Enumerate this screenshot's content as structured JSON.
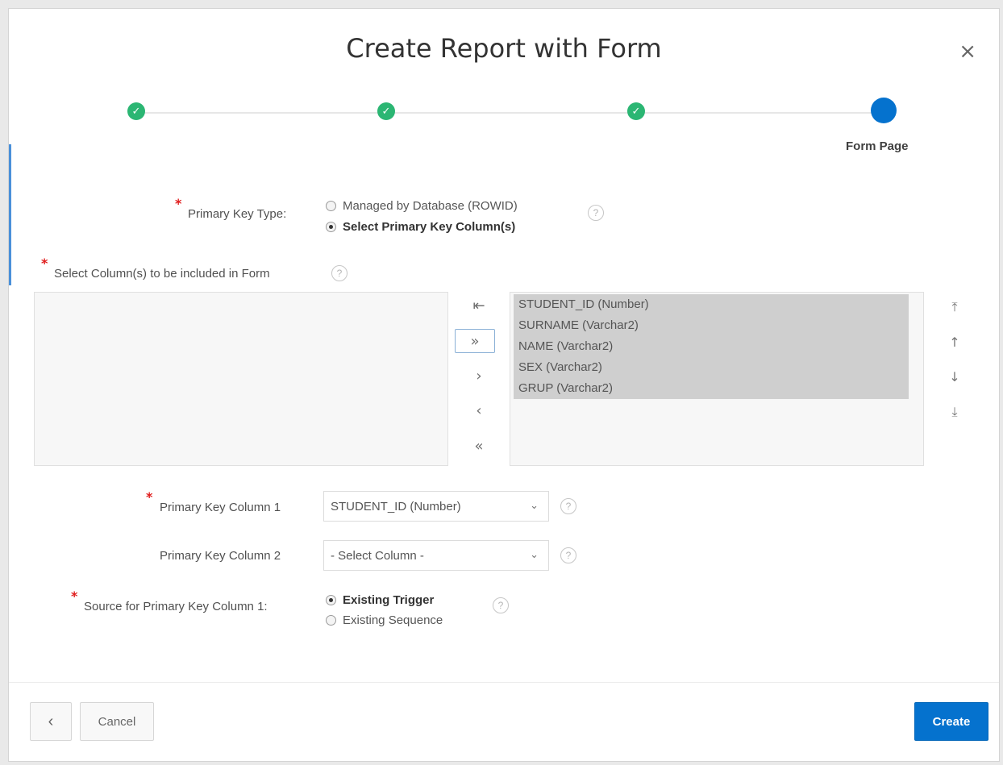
{
  "dialog": {
    "title": "Create Report with Form",
    "close_glyph": "×"
  },
  "wizard": {
    "completed_check": "✓",
    "current_label": "Form Page"
  },
  "primary_key_type": {
    "label": "Primary Key Type:",
    "options": [
      {
        "label": "Managed by Database (ROWID)",
        "selected": false
      },
      {
        "label": "Select Primary Key Column(s)",
        "selected": true
      }
    ]
  },
  "columns": {
    "label": "Select Column(s) to be included in Form",
    "available": [],
    "selected": [
      "STUDENT_ID (Number)",
      "SURNAME (Varchar2)",
      "NAME (Varchar2)",
      "SEX (Varchar2)",
      "GRUP (Varchar2)"
    ],
    "shuttle_buttons": {
      "reset": "⇤",
      "move_all": "»",
      "move": "›",
      "remove": "‹",
      "remove_all": "«"
    },
    "reorder_buttons": {
      "top": "⤒",
      "up": "↑",
      "down": "↓",
      "bottom": "⤓"
    }
  },
  "pk_column_1": {
    "label": "Primary Key Column 1",
    "value": "STUDENT_ID (Number)"
  },
  "pk_column_2": {
    "label": "Primary Key Column 2",
    "value": "- Select Column -"
  },
  "pk_source": {
    "label": "Source for Primary Key Column 1:",
    "options": [
      {
        "label": "Existing Trigger",
        "selected": true
      },
      {
        "label": "Existing Sequence",
        "selected": false
      }
    ]
  },
  "help_glyph": "?",
  "chevron_glyph": "⌄",
  "required_glyph": "*",
  "footer": {
    "back_glyph": "‹",
    "cancel_label": "Cancel",
    "create_label": "Create"
  },
  "colors": {
    "accent": "#0572ce",
    "success": "#2bb673",
    "required": "#e01b1b"
  }
}
